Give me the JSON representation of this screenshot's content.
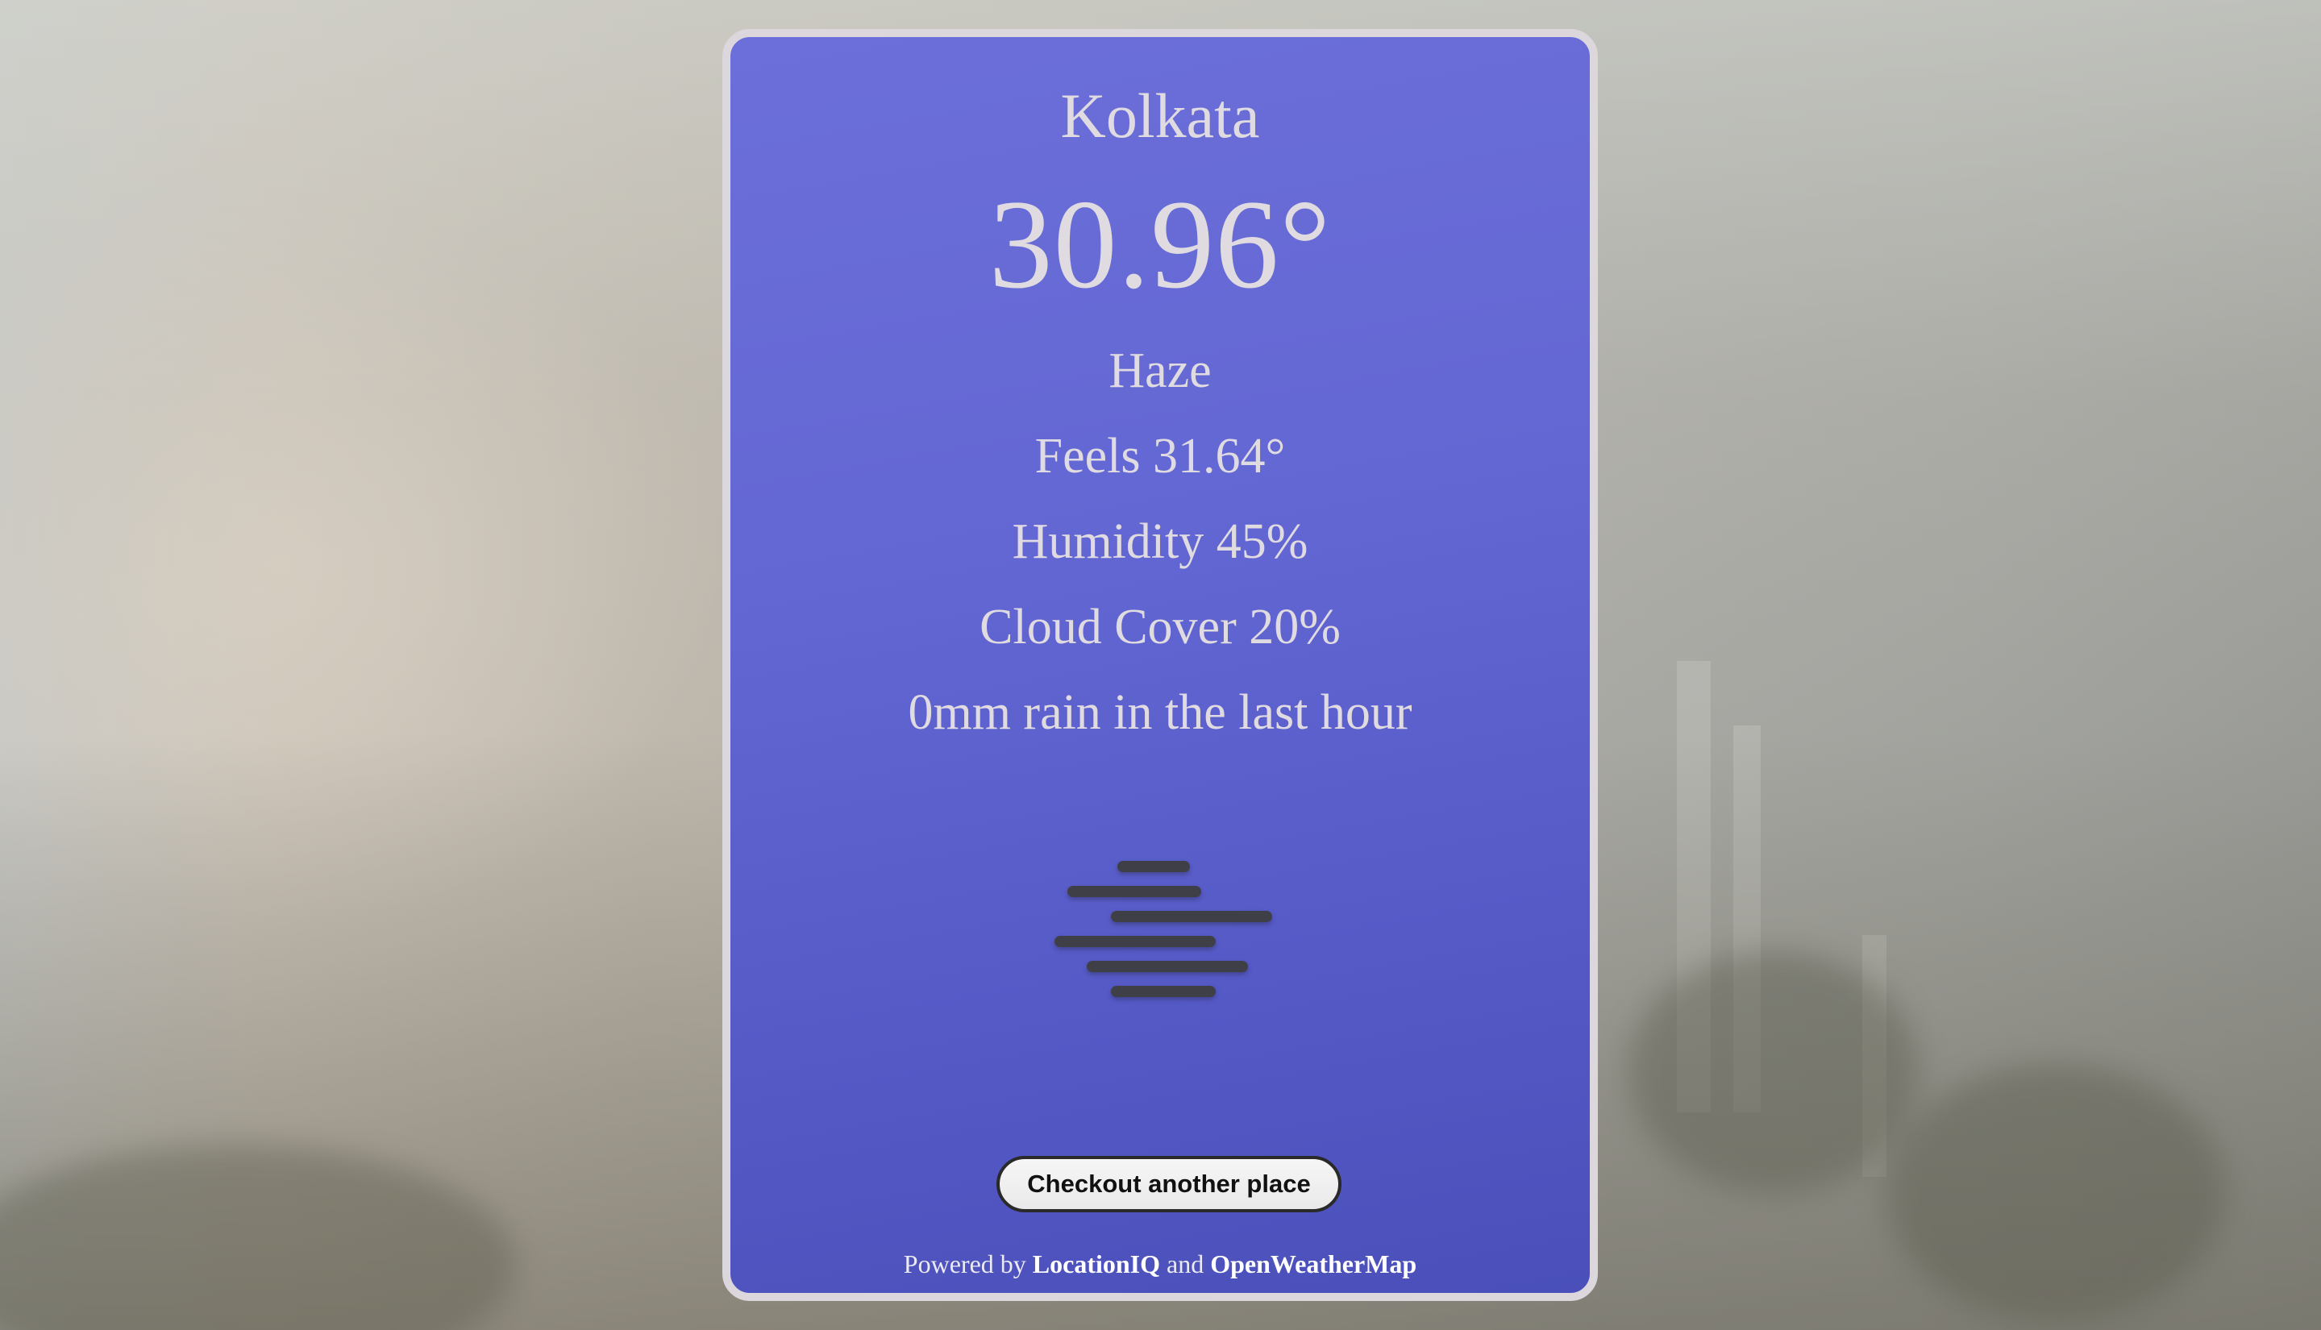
{
  "weather": {
    "city": "Kolkata",
    "temperature": "30.96°",
    "condition": "Haze",
    "feels_like": "Feels 31.64°",
    "humidity": "Humidity 45%",
    "cloud_cover": "Cloud Cover 20%",
    "rain": "0mm rain in the last hour",
    "icon": "haze-icon"
  },
  "actions": {
    "checkout_label": "Checkout another place"
  },
  "footer": {
    "powered_by": "Powered by",
    "provider_1": "LocationIQ",
    "and": "and",
    "provider_2": "OpenWeatherMap"
  },
  "colors": {
    "card_background": "#6367d3",
    "card_border": "#dcd7dc",
    "text": "#e0dbe0",
    "icon": "#3f4047"
  }
}
